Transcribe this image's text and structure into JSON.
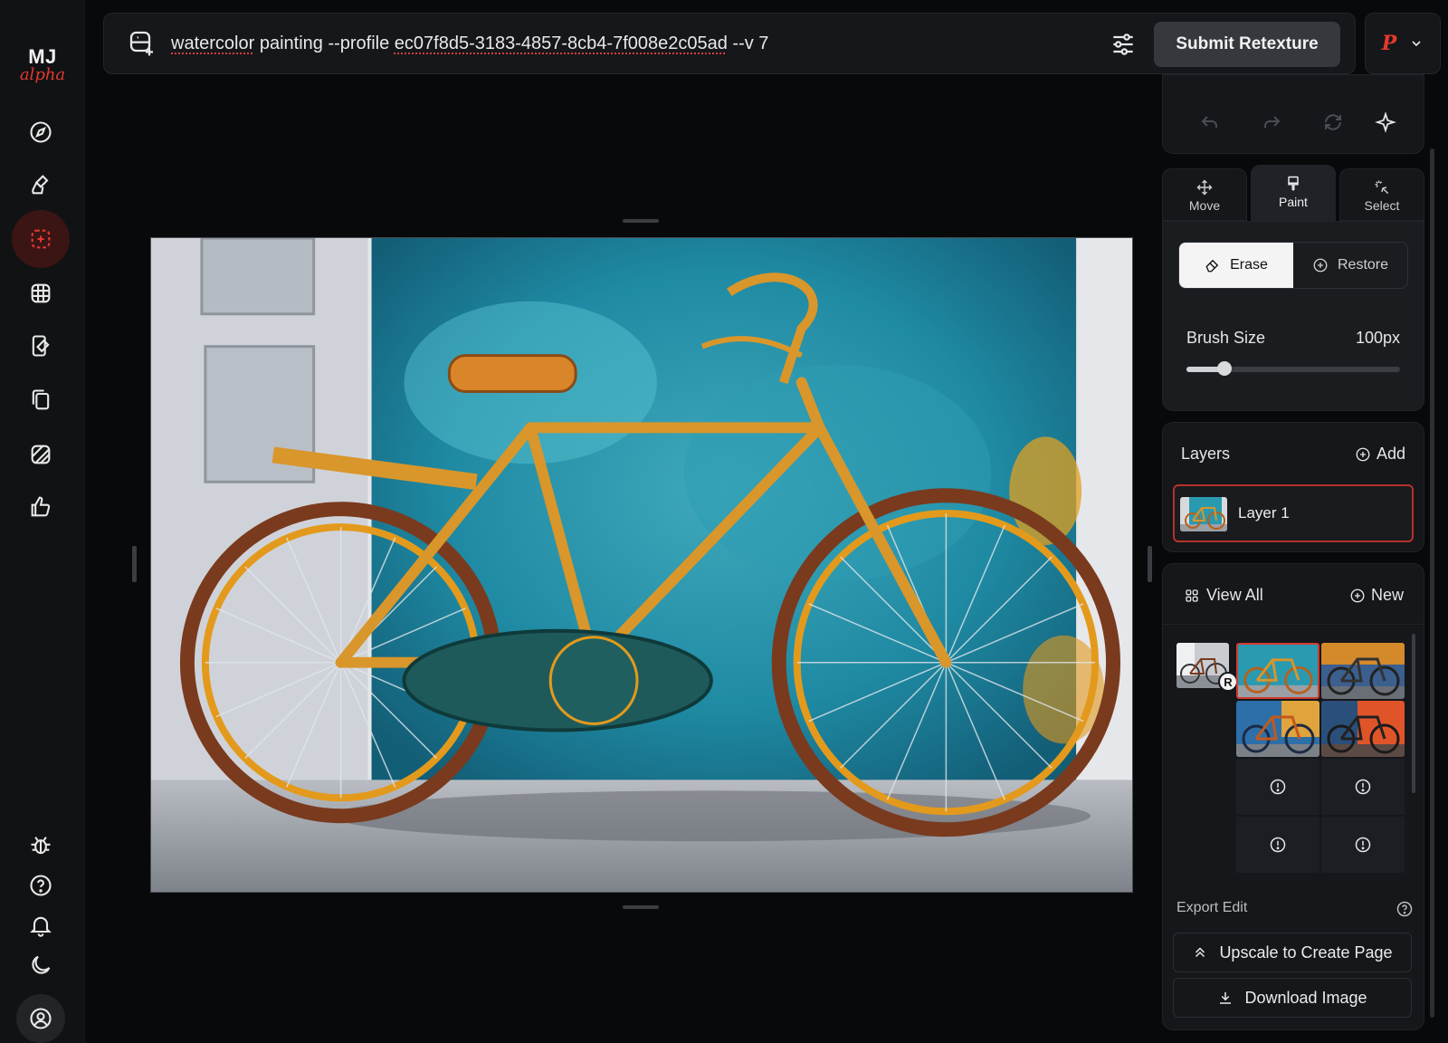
{
  "rail": {
    "logo_top": "MJ",
    "logo_bottom": "alpha",
    "items": [
      "explore-icon",
      "create-icon",
      "edit-icon",
      "organize-icon",
      "personalize-icon",
      "moodboards-icon",
      "rate-icon",
      "like-icon"
    ],
    "bottom_items": [
      "bug-icon",
      "help-icon",
      "notification-icon",
      "dark-mode-icon",
      "account-icon"
    ]
  },
  "prompt": {
    "part1": "watercolor",
    "part2": " painting --profile ",
    "part3": "ec07f8d5-3183-4857-8cb4-7f008e2c05ad",
    "part4": " --v 7",
    "submit_label": "Submit Retexture",
    "profile_letter": "P"
  },
  "tools": {
    "tabs": [
      {
        "label": "Move",
        "icon": "move-icon"
      },
      {
        "label": "Paint",
        "icon": "paint-brush-icon"
      },
      {
        "label": "Select",
        "icon": "select-wand-icon"
      }
    ],
    "active_tab": "Paint",
    "erase_label": "Erase",
    "restore_label": "Restore",
    "brush_label": "Brush Size",
    "brush_value": "100px",
    "brush_fraction": 0.18
  },
  "layers": {
    "title": "Layers",
    "add_label": "Add",
    "items": [
      {
        "name": "Layer 1"
      }
    ]
  },
  "gallery": {
    "view_all_label": "View All",
    "new_label": "New",
    "badge": "R"
  },
  "export": {
    "label": "Export Edit",
    "upscale_label": "Upscale to Create Page",
    "download_label": "Download Image"
  },
  "colors": {
    "accent": "#e3392f",
    "background": "#07090b",
    "panel": "#15171a"
  }
}
